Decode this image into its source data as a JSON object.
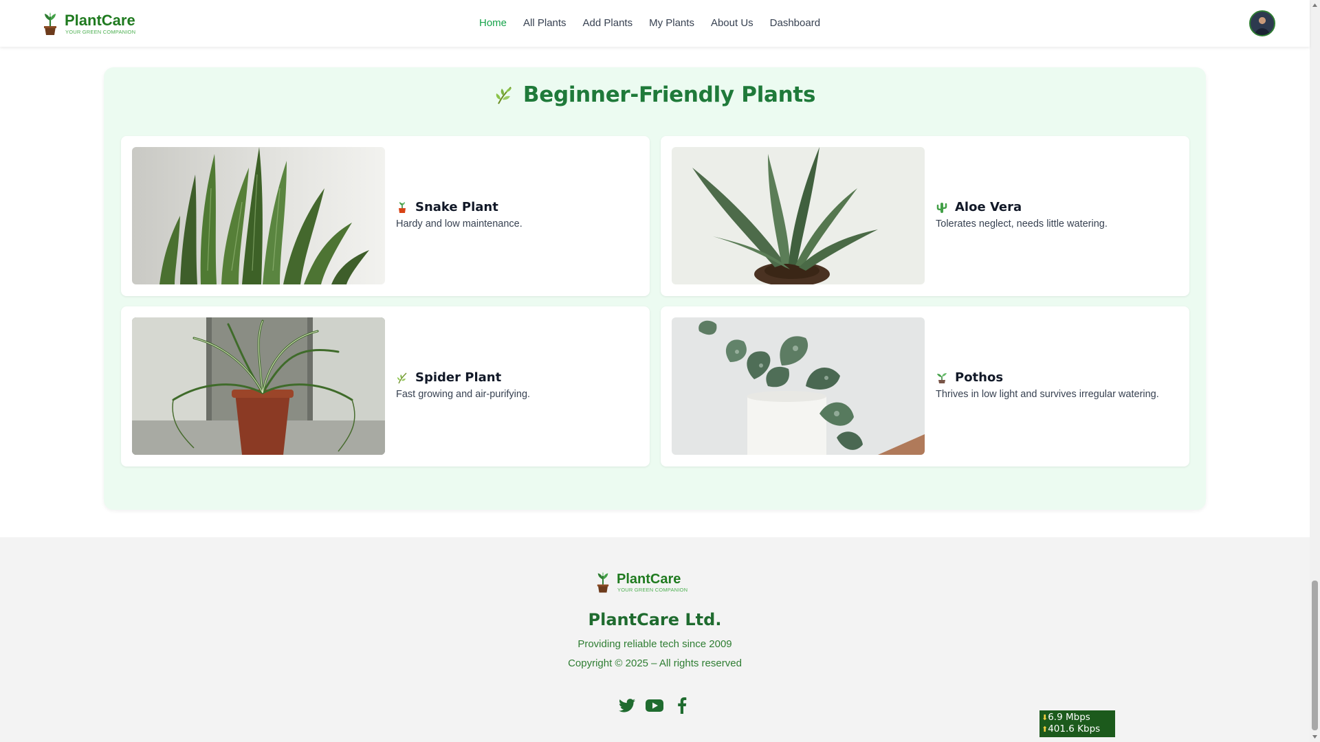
{
  "brand": {
    "name": "PlantCare",
    "tagline": "YOUR GREEN COMPANION",
    "primary_color": "#1f7a3a",
    "accent_color": "#16a34a"
  },
  "nav": {
    "links": [
      {
        "label": "Home",
        "active": true
      },
      {
        "label": "All Plants",
        "active": false
      },
      {
        "label": "Add Plants",
        "active": false
      },
      {
        "label": "My Plants",
        "active": false
      },
      {
        "label": "About Us",
        "active": false
      },
      {
        "label": "Dashboard",
        "active": false
      }
    ],
    "avatar_icon": "user-avatar"
  },
  "section": {
    "title": "Beginner-Friendly Plants",
    "title_icon": "herb-icon",
    "plants": [
      {
        "name": "Snake Plant",
        "icon": "potted-plant-icon",
        "description": "Hardy and low maintenance."
      },
      {
        "name": "Aloe Vera",
        "icon": "cactus-icon",
        "description": "Tolerates neglect, needs little watering."
      },
      {
        "name": "Spider Plant",
        "icon": "herb-icon",
        "description": "Fast growing and air-purifying."
      },
      {
        "name": "Pothos",
        "icon": "seedling-icon",
        "description": "Thrives in low light and survives irregular watering."
      }
    ]
  },
  "footer": {
    "company": "PlantCare Ltd.",
    "line1": "Providing reliable tech since 2009",
    "line2": "Copyright © 2025 – All rights reserved",
    "socials": [
      "twitter-icon",
      "youtube-icon",
      "facebook-icon"
    ]
  },
  "netspeed": {
    "down": "6.9 Mbps",
    "up": "401.6 Kbps"
  }
}
